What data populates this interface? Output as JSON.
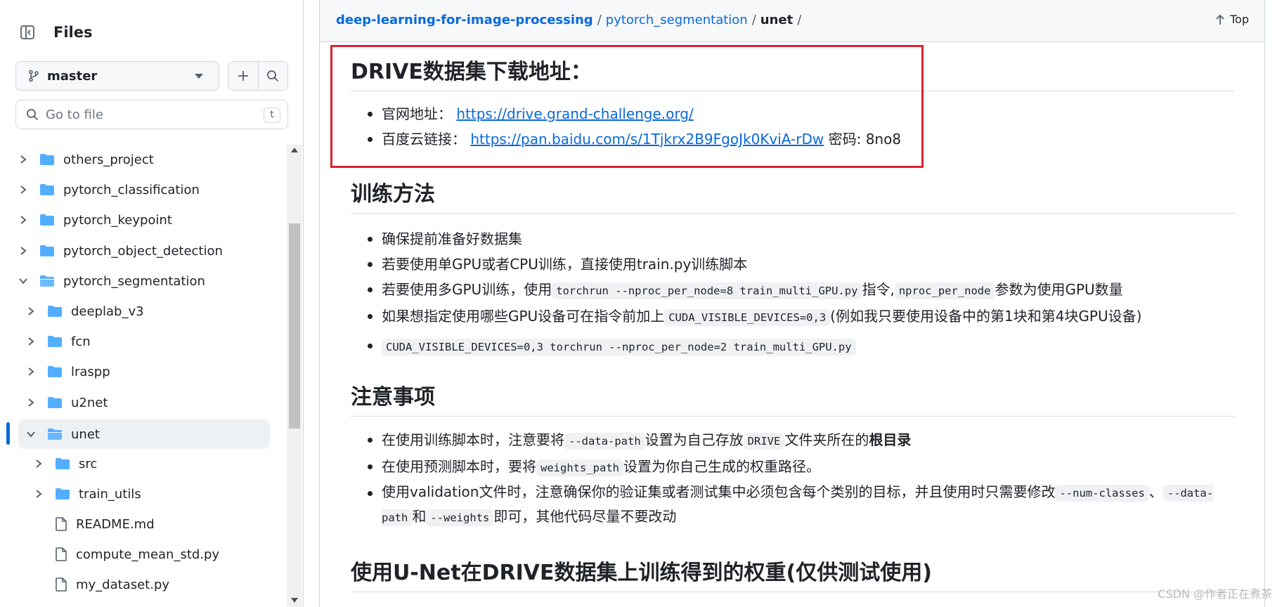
{
  "sidebar": {
    "title": "Files",
    "branch": "master",
    "goto_placeholder": "Go to file",
    "goto_shortcut": "t",
    "tree": [
      {
        "label": "others_project",
        "level": 0,
        "expanded": false,
        "type": "folder"
      },
      {
        "label": "pytorch_classification",
        "level": 0,
        "expanded": false,
        "type": "folder"
      },
      {
        "label": "pytorch_keypoint",
        "level": 0,
        "expanded": false,
        "type": "folder"
      },
      {
        "label": "pytorch_object_detection",
        "level": 0,
        "expanded": false,
        "type": "folder"
      },
      {
        "label": "pytorch_segmentation",
        "level": 0,
        "expanded": true,
        "type": "folder"
      },
      {
        "label": "deeplab_v3",
        "level": 1,
        "expanded": false,
        "type": "folder"
      },
      {
        "label": "fcn",
        "level": 1,
        "expanded": false,
        "type": "folder"
      },
      {
        "label": "lraspp",
        "level": 1,
        "expanded": false,
        "type": "folder"
      },
      {
        "label": "u2net",
        "level": 1,
        "expanded": false,
        "type": "folder"
      },
      {
        "label": "unet",
        "level": 1,
        "expanded": true,
        "type": "folder",
        "selected": true
      },
      {
        "label": "src",
        "level": 2,
        "expanded": false,
        "type": "folder"
      },
      {
        "label": "train_utils",
        "level": 2,
        "expanded": false,
        "type": "folder"
      },
      {
        "label": "README.md",
        "level": 2,
        "type": "file"
      },
      {
        "label": "compute_mean_std.py",
        "level": 2,
        "type": "file"
      },
      {
        "label": "my_dataset.py",
        "level": 2,
        "type": "file"
      }
    ]
  },
  "breadcrumb": {
    "repo": "deep-learning-for-image-processing",
    "dir": "pytorch_segmentation",
    "current": "unet",
    "sep": "/"
  },
  "top_label": "Top",
  "sections": {
    "drive": {
      "heading": "DRIVE数据集下载地址：",
      "item1_label": "官网地址：",
      "item1_link": "https://drive.grand-challenge.org/",
      "item2_label": "百度云链接：",
      "item2_link": "https://pan.baidu.com/s/1Tjkrx2B9FgoJk0KviA-rDw",
      "item2_suffix": "密码: 8no8"
    },
    "train": {
      "heading": "训练方法",
      "li1": "确保提前准备好数据集",
      "li2": "若要使用单GPU或者CPU训练，直接使用train.py训练脚本",
      "li3_a": "若要使用多GPU训练，使用",
      "li3_code1": "torchrun --nproc_per_node=8 train_multi_GPU.py",
      "li3_b": "指令,",
      "li3_code2": "nproc_per_node",
      "li3_c": "参数为使用GPU数量",
      "li4_a": "如果想指定使用哪些GPU设备可在指令前加上",
      "li4_code": "CUDA_VISIBLE_DEVICES=0,3",
      "li4_b": "(例如我只要使用设备中的第1块和第4块GPU设备)",
      "li5_code": "CUDA_VISIBLE_DEVICES=0,3 torchrun --nproc_per_node=2 train_multi_GPU.py"
    },
    "notes": {
      "heading": "注意事项",
      "li1_a": "在使用训练脚本时，注意要将",
      "li1_code1": "--data-path",
      "li1_b": "设置为自己存放",
      "li1_code2": "DRIVE",
      "li1_c": "文件夹所在的",
      "li1_bold": "根目录",
      "li2_a": "在使用预测脚本时，要将",
      "li2_code": "weights_path",
      "li2_b": "设置为你自己生成的权重路径。",
      "li3_a": "使用validation文件时，注意确保你的验证集或者测试集中必须包含每个类别的目标，并且使用时只需要修改",
      "li3_code1": "--num-classes",
      "li3_b": "、",
      "li3_code2": "--data-path",
      "li3_c": "和",
      "li3_code3": "--weights",
      "li3_d": "即可，其他代码尽量不要改动"
    },
    "weights": {
      "heading": "使用U-Net在DRIVE数据集上训练得到的权重(仅供测试使用)"
    }
  },
  "watermark": "CSDN @作者正在煮茶",
  "colors": {
    "link": "#0969da",
    "highlight_box": "#d8232f",
    "folder": "#54aeff"
  }
}
